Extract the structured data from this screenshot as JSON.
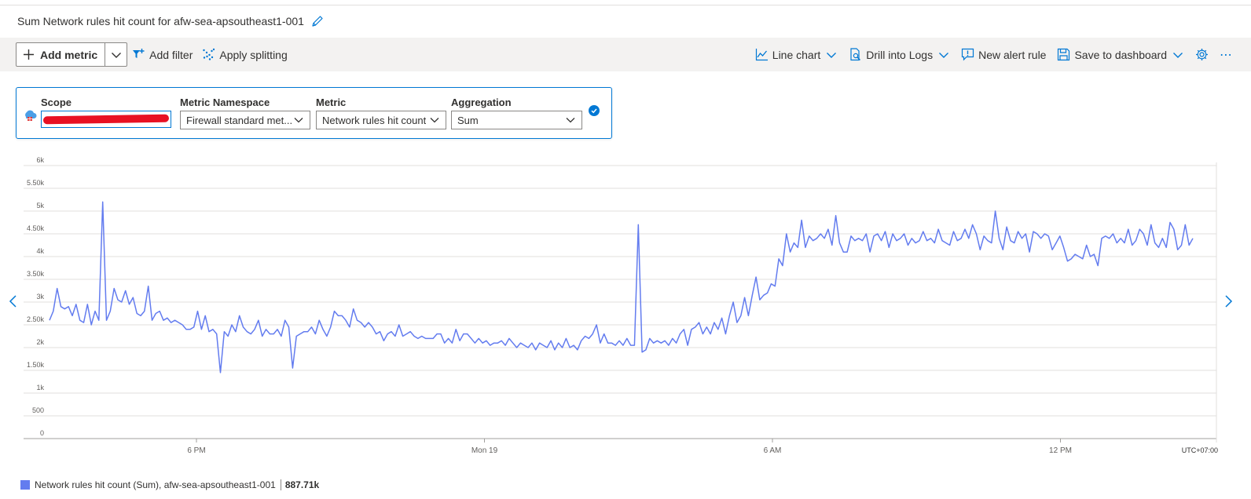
{
  "header": {
    "title": "Sum Network rules hit count for afw-sea-apsoutheast1-001",
    "edit_icon": "pencil-icon"
  },
  "toolbar": {
    "add_metric_label": "Add metric",
    "add_filter_label": "Add filter",
    "apply_splitting_label": "Apply splitting",
    "line_chart_label": "Line chart",
    "drill_logs_label": "Drill into Logs",
    "new_alert_label": "New alert rule",
    "save_dashboard_label": "Save to dashboard",
    "more_label": "⋯"
  },
  "metric_row": {
    "scope_label": "Scope",
    "scope_value": "",
    "namespace_label": "Metric Namespace",
    "namespace_value": "Firewall standard met...",
    "metric_label": "Metric",
    "metric_value": "Network rules hit count",
    "aggregation_label": "Aggregation",
    "aggregation_value": "Sum"
  },
  "legend": {
    "series_label": "Network rules hit count (Sum), afw-sea-apsoutheast1-001",
    "total": "887.71k"
  },
  "colors": {
    "accent": "#0078d4",
    "series": "#637cef",
    "redaction": "#e81123"
  },
  "chart_data": {
    "type": "line",
    "ylim": [
      0,
      6000
    ],
    "y_ticks": [
      "0",
      "500",
      "1k",
      "1.50k",
      "2k",
      "2.50k",
      "3k",
      "3.50k",
      "4k",
      "4.50k",
      "5k",
      "5.50k",
      "6k"
    ],
    "x_ticks": [
      {
        "label": "6 PM",
        "pos": 0.1
      },
      {
        "label": "Mon 19",
        "pos": 0.3
      },
      {
        "label": "6 AM",
        "pos": 0.5
      },
      {
        "label": "12 PM",
        "pos": 0.7
      }
    ],
    "timezone": "UTC+07:00",
    "series": [
      {
        "name": "Network rules hit count (Sum), afw-sea-apsoutheast1-001",
        "values": [
          2600,
          2800,
          3300,
          2900,
          2850,
          2900,
          2700,
          2950,
          2600,
          2550,
          2950,
          2500,
          2800,
          2600,
          5200,
          2600,
          2800,
          3300,
          3050,
          3000,
          3250,
          2950,
          3100,
          2750,
          2700,
          2800,
          3350,
          2600,
          2750,
          2800,
          2600,
          2650,
          2550,
          2600,
          2550,
          2500,
          2400,
          2400,
          2450,
          2800,
          2400,
          2700,
          2350,
          2400,
          2300,
          1450,
          2350,
          2250,
          2500,
          2350,
          2700,
          2450,
          2350,
          2300,
          2400,
          2600,
          2250,
          2400,
          2300,
          2300,
          2400,
          2250,
          2600,
          2450,
          1550,
          2250,
          2300,
          2350,
          2350,
          2450,
          2300,
          2600,
          2400,
          2250,
          2450,
          2800,
          2700,
          2700,
          2600,
          2450,
          2850,
          2600,
          2550,
          2450,
          2550,
          2450,
          2300,
          2350,
          2150,
          2300,
          2350,
          2250,
          2500,
          2250,
          2300,
          2350,
          2250,
          2200,
          2250,
          2200,
          2200,
          2200,
          2300,
          2300,
          2100,
          2200,
          2100,
          2400,
          2150,
          2300,
          2300,
          2200,
          2100,
          2200,
          2100,
          2150,
          2050,
          2100,
          2100,
          2150,
          2050,
          2200,
          2100,
          2000,
          2100,
          2050,
          2000,
          2100,
          1950,
          2100,
          2050,
          2000,
          2150,
          1950,
          2100,
          2000,
          2200,
          2000,
          2050,
          1950,
          2150,
          2250,
          2200,
          2300,
          2500,
          2100,
          2300,
          2100,
          2100,
          2050,
          2150,
          2050,
          2200,
          2050,
          2050,
          4700,
          1900,
          1950,
          2200,
          2100,
          2150,
          2100,
          2150,
          2050,
          2200,
          2100,
          2300,
          2400,
          2050,
          2400,
          2450,
          2550,
          2300,
          2450,
          2300,
          2550,
          2400,
          2650,
          2300,
          2700,
          3000,
          2550,
          2700,
          3100,
          2700,
          3150,
          3550,
          3050,
          3150,
          3200,
          3400,
          3350,
          3950,
          3800,
          4500,
          4100,
          4300,
          4200,
          4800,
          4200,
          4450,
          4350,
          4400,
          4500,
          4400,
          4600,
          4250,
          4900,
          4300,
          4100,
          4100,
          4450,
          4350,
          4400,
          4350,
          4500,
          4100,
          4450,
          4500,
          4350,
          4550,
          4200,
          4500,
          4350,
          4400,
          4500,
          4250,
          4400,
          4300,
          4350,
          4550,
          4350,
          4400,
          4300,
          4600,
          4350,
          4300,
          4250,
          4550,
          4350,
          4400,
          4600,
          4400,
          4700,
          4500,
          4150,
          4450,
          4350,
          4300,
          5000,
          4400,
          4150,
          4650,
          4350,
          4300,
          4550,
          4400,
          4500,
          4100,
          4550,
          4500,
          4400,
          4500,
          4450,
          4150,
          4300,
          4450,
          4200,
          3900,
          3950,
          4050,
          4000,
          3950,
          4250,
          4000,
          4050,
          3800,
          4400,
          4450,
          4400,
          4500,
          4300,
          4400,
          4300,
          4600,
          4250,
          4350,
          4600,
          4500,
          4250,
          4700,
          4300,
          4200,
          4400,
          4200,
          4750,
          4600,
          4150,
          4250,
          4700,
          4250,
          4400
        ]
      }
    ]
  }
}
